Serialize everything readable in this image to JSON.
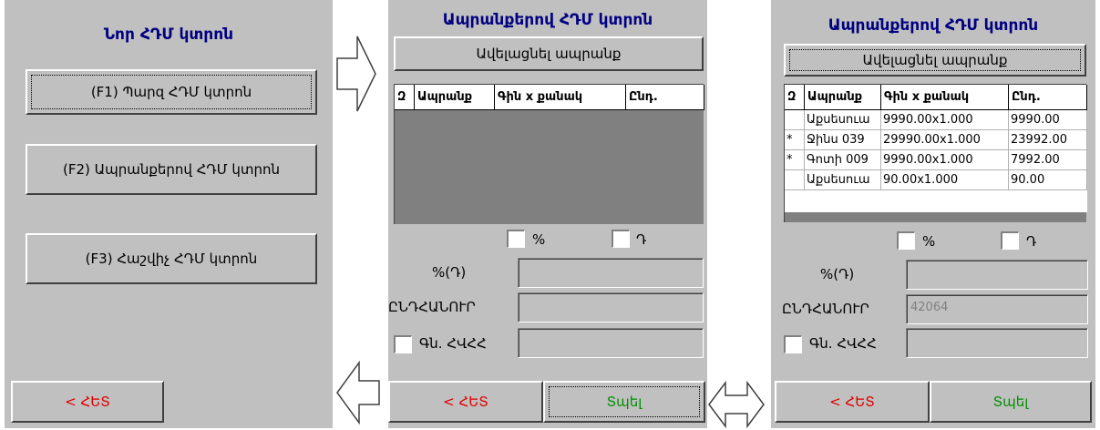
{
  "screen1": {
    "title": "Նոր ՀԴՄ կտրոն",
    "btn_f1": "(F1) Պարզ ՀԴՄ կտրոն",
    "btn_f2": "(F2) Ապրանքերով ՀԴՄ կտրոն",
    "btn_f3": "(F3) Հաշվիչ ՀԴՄ կտրոն",
    "back": "< ՀԵՏ"
  },
  "screen2": {
    "title": "Ապրանքերով ՀԴՄ կտրոն",
    "add_item": "Ավելացնել ապրանք",
    "columns": [
      "Զ",
      "Ապրանք",
      "Գին x քանակ",
      "Ընդ."
    ],
    "percent_label": "%",
    "dram_label": "Դ",
    "discount_label": "%(Դ)",
    "total_label": "ԸՆԴՀԱՆՈՒՐ",
    "card_label": "Գն. ՀՎՀՀ",
    "back": "< ՀԵՏ",
    "print": "Տպել"
  },
  "screen3": {
    "title": "Ապրանքերով ՀԴՄ կտրոն",
    "add_item": "Ավելացնել ապրանք",
    "columns": [
      "Զ",
      "Ապրանք",
      "Գին x քանակ",
      "Ընդ."
    ],
    "rows": [
      {
        "mark": "",
        "item": "Աքսեսուա",
        "price": "9990.00x1.000",
        "total": "9990.00"
      },
      {
        "mark": "*",
        "item": "Ջինս 039",
        "price": "29990.00x1.000",
        "total": "23992.00"
      },
      {
        "mark": "*",
        "item": "Գոտի 009",
        "price": "9990.00x1.000",
        "total": "7992.00"
      },
      {
        "mark": "",
        "item": "Աքսեսուա",
        "price": "90.00x1.000",
        "total": "90.00"
      }
    ],
    "percent_label": "%",
    "dram_label": "Դ",
    "discount_label": "%(Դ)",
    "total_label": "ԸՆԴՀԱՆՈՒՐ",
    "total_value": "42064",
    "card_label": "Գն. ՀՎՀՀ",
    "back": "< ՀԵՏ",
    "print": "Տպել"
  },
  "colors": {
    "panel": "#c0c0c0",
    "title": "#000080",
    "back": "#e00000",
    "print": "#009000"
  },
  "icons": [
    "arrow-right-icon",
    "arrow-left-icon",
    "arrow-double-icon"
  ]
}
